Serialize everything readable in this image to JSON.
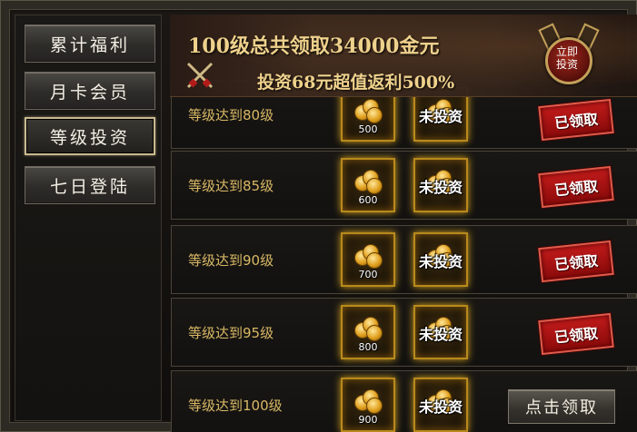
{
  "sidebar": {
    "items": [
      {
        "label": "累计福利"
      },
      {
        "label": "月卡会员"
      },
      {
        "label": "等级投资",
        "active": true
      },
      {
        "label": "七日登陆"
      }
    ]
  },
  "banner": {
    "line1": "100级总共领取34000金元",
    "line2": "投资68元超值返利500%",
    "invest_button": "立即投资"
  },
  "rows": [
    {
      "label": "等级达到80级",
      "amount": "500",
      "slot2_text": "未投资",
      "status": "已领取"
    },
    {
      "label": "等级达到85级",
      "amount": "600",
      "slot2_text": "未投资",
      "status": "已领取"
    },
    {
      "label": "等级达到90级",
      "amount": "700",
      "slot2_text": "未投资",
      "status": "已领取"
    },
    {
      "label": "等级达到95级",
      "amount": "800",
      "slot2_text": "未投资",
      "status": "已领取"
    },
    {
      "label": "等级达到100级",
      "amount": "900",
      "slot2_text": "未投资",
      "action": "点击领取"
    }
  ],
  "colors": {
    "accent_gold": "#f5d890",
    "label_gold": "#d8b865",
    "claimed_red": "#c21b1b",
    "slot_glow": "#d9a51f"
  }
}
